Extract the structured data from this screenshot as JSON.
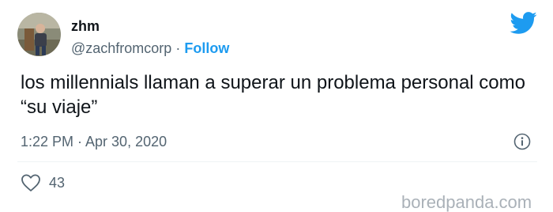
{
  "tweet": {
    "display_name": "zhm",
    "handle": "@zachfromcorp",
    "separator": "·",
    "follow_label": "Follow",
    "text": "los millennials llaman a superar un problema personal como “su viaje”",
    "timestamp": "1:22 PM · Apr 30, 2020",
    "like_count": "43"
  },
  "watermark": {
    "text": "boredpanda.com"
  },
  "icons": {
    "brand": "twitter-bird-icon",
    "info": "info-icon",
    "like": "heart-icon"
  },
  "colors": {
    "accent": "#1d9bf0",
    "text_primary": "#0f1419",
    "text_secondary": "#536471",
    "divider": "#eff3f4"
  }
}
